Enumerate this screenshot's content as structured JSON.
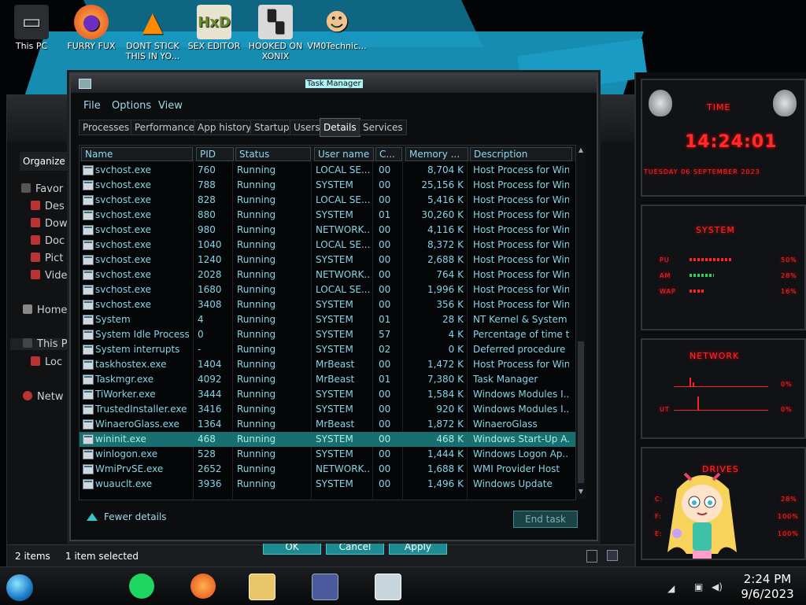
{
  "desktop_icons": [
    {
      "label": "This PC",
      "icon": "computer-icon"
    },
    {
      "label": "FURRY FUX",
      "icon": "firefox-icon"
    },
    {
      "label": "DONT STICK THIS IN YO...",
      "icon": "vlc-cone-icon"
    },
    {
      "label": "SEX EDITOR",
      "icon": "hex-editor-icon"
    },
    {
      "label": "HOOKED ON XONIX",
      "icon": "game-icon"
    },
    {
      "label": "VM0Technic...",
      "icon": "doctor-icon"
    }
  ],
  "explorer": {
    "organize_label": "Organize",
    "nav_items": [
      "Favor",
      "Des",
      "Dow",
      "Doc",
      "Pict",
      "Vide",
      "Home",
      "This P",
      "Loc",
      "Netw"
    ],
    "status_items": "2 items",
    "status_selected": "1 item selected",
    "ok_label": "OK",
    "cancel_label": "Cancel",
    "apply_label": "Apply"
  },
  "task_manager": {
    "title": "Task Manager",
    "menu": [
      "File",
      "Options",
      "View"
    ],
    "tabs": [
      "Processes",
      "Performance",
      "App history",
      "Startup",
      "Users",
      "Details",
      "Services"
    ],
    "active_tab": "Details",
    "columns": [
      "Name",
      "PID",
      "Status",
      "User name",
      "C...",
      "Memory ...",
      "Description"
    ],
    "rows": [
      {
        "name": "svchost.exe",
        "pid": "760",
        "status": "Running",
        "user": "LOCAL SE...",
        "cpu": "00",
        "memory": "8,704 K",
        "desc": "Host Process for Win..."
      },
      {
        "name": "svchost.exe",
        "pid": "788",
        "status": "Running",
        "user": "SYSTEM",
        "cpu": "00",
        "memory": "25,156 K",
        "desc": "Host Process for Win..."
      },
      {
        "name": "svchost.exe",
        "pid": "828",
        "status": "Running",
        "user": "LOCAL SE...",
        "cpu": "00",
        "memory": "5,416 K",
        "desc": "Host Process for Win..."
      },
      {
        "name": "svchost.exe",
        "pid": "880",
        "status": "Running",
        "user": "SYSTEM",
        "cpu": "01",
        "memory": "30,260 K",
        "desc": "Host Process for Win..."
      },
      {
        "name": "svchost.exe",
        "pid": "980",
        "status": "Running",
        "user": "NETWORK...",
        "cpu": "00",
        "memory": "4,116 K",
        "desc": "Host Process for Win..."
      },
      {
        "name": "svchost.exe",
        "pid": "1040",
        "status": "Running",
        "user": "LOCAL SE...",
        "cpu": "00",
        "memory": "8,372 K",
        "desc": "Host Process for Win..."
      },
      {
        "name": "svchost.exe",
        "pid": "1240",
        "status": "Running",
        "user": "SYSTEM",
        "cpu": "00",
        "memory": "2,688 K",
        "desc": "Host Process for Win..."
      },
      {
        "name": "svchost.exe",
        "pid": "2028",
        "status": "Running",
        "user": "NETWORK...",
        "cpu": "00",
        "memory": "764 K",
        "desc": "Host Process for Win..."
      },
      {
        "name": "svchost.exe",
        "pid": "1680",
        "status": "Running",
        "user": "LOCAL SE...",
        "cpu": "00",
        "memory": "1,996 K",
        "desc": "Host Process for Win..."
      },
      {
        "name": "svchost.exe",
        "pid": "3408",
        "status": "Running",
        "user": "SYSTEM",
        "cpu": "00",
        "memory": "356 K",
        "desc": "Host Process for Win..."
      },
      {
        "name": "System",
        "pid": "4",
        "status": "Running",
        "user": "SYSTEM",
        "cpu": "01",
        "memory": "28 K",
        "desc": "NT Kernel & System"
      },
      {
        "name": "System Idle Process",
        "pid": "0",
        "status": "Running",
        "user": "SYSTEM",
        "cpu": "57",
        "memory": "4 K",
        "desc": "Percentage of time t..."
      },
      {
        "name": "System interrupts",
        "pid": "-",
        "status": "Running",
        "user": "SYSTEM",
        "cpu": "02",
        "memory": "0 K",
        "desc": "Deferred procedure ..."
      },
      {
        "name": "taskhostex.exe",
        "pid": "1404",
        "status": "Running",
        "user": "MrBeast",
        "cpu": "00",
        "memory": "1,472 K",
        "desc": "Host Process for Win..."
      },
      {
        "name": "Taskmgr.exe",
        "pid": "4092",
        "status": "Running",
        "user": "MrBeast",
        "cpu": "01",
        "memory": "7,380 K",
        "desc": "Task Manager"
      },
      {
        "name": "TiWorker.exe",
        "pid": "3444",
        "status": "Running",
        "user": "SYSTEM",
        "cpu": "00",
        "memory": "1,584 K",
        "desc": "Windows Modules I..."
      },
      {
        "name": "TrustedInstaller.exe",
        "pid": "3416",
        "status": "Running",
        "user": "SYSTEM",
        "cpu": "00",
        "memory": "920 K",
        "desc": "Windows Modules I..."
      },
      {
        "name": "WinaeroGlass.exe",
        "pid": "1364",
        "status": "Running",
        "user": "MrBeast",
        "cpu": "00",
        "memory": "1,872 K",
        "desc": "WinaeroGlass"
      },
      {
        "name": "wininit.exe",
        "pid": "468",
        "status": "Running",
        "user": "SYSTEM",
        "cpu": "00",
        "memory": "468 K",
        "desc": "Windows Start-Up A..."
      },
      {
        "name": "winlogon.exe",
        "pid": "528",
        "status": "Running",
        "user": "SYSTEM",
        "cpu": "00",
        "memory": "1,444 K",
        "desc": "Windows Logon Ap..."
      },
      {
        "name": "WmiPrvSE.exe",
        "pid": "2652",
        "status": "Running",
        "user": "NETWORK...",
        "cpu": "00",
        "memory": "1,688 K",
        "desc": "WMI Provider Host"
      },
      {
        "name": "wuauclt.exe",
        "pid": "3936",
        "status": "Running",
        "user": "SYSTEM",
        "cpu": "00",
        "memory": "1,496 K",
        "desc": "Windows Update"
      }
    ],
    "selected_row": 18,
    "fewer_details": "Fewer details",
    "end_task": "End task"
  },
  "gadgets": {
    "time_title": "TIME",
    "time_value": "14:24:01",
    "date_value": "TUESDAY 06 SEPTEMBER 2023",
    "system_title": "SYSTEM",
    "cpu_label": "PU",
    "cpu_value": "50%",
    "cpu_level": 0.5,
    "ram_label": "AM",
    "ram_value": "28%",
    "ram_level": 0.28,
    "swap_label": "WAP",
    "swap_value": "16%",
    "swap_level": 0.16,
    "network_title": "NETWORK",
    "net_in_value": "0%",
    "net_out_label": "UT",
    "net_out_value": "0%",
    "drives_title": "DRIVES",
    "drive_c_label": "C:",
    "drive_c_value": "28%",
    "drive_f_label": "F:",
    "drive_f_value": "100%",
    "drive_e_label": "E:",
    "drive_e_value": "100%"
  },
  "taskbar": {
    "apps": [
      "spotify-icon",
      "firefox-icon",
      "file-explorer-icon",
      "control-panel-icon",
      "task-manager-icon"
    ],
    "time": "2:24 PM",
    "date": "9/6/2023"
  },
  "colors": {
    "accent": "#35c7c9",
    "text_cyan": "#87d4e6",
    "selected_row": "#176f70",
    "gadget_red": "#ff2b2b",
    "wallpaper_blue": "#1a9bc4"
  }
}
